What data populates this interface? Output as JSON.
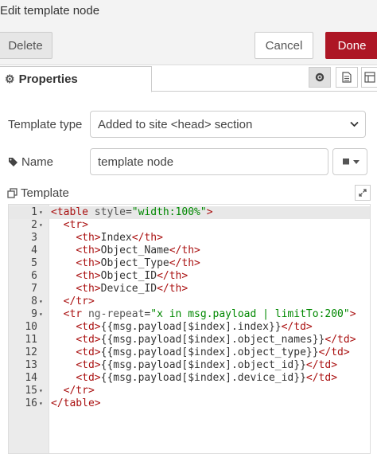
{
  "header": {
    "title": "Edit template node"
  },
  "toolbar": {
    "delete_label": "Delete",
    "cancel_label": "Cancel",
    "done_label": "Done"
  },
  "tabs": {
    "properties_label": "Properties",
    "icons": [
      "gear-icon",
      "document-icon",
      "layout-icon"
    ]
  },
  "form": {
    "template_type_label": "Template type",
    "template_type_value": "Added to site <head> section",
    "name_label": "Name",
    "name_value": "template node",
    "template_label": "Template"
  },
  "editor": {
    "lines": [
      {
        "num": "1",
        "fold": true,
        "tokens": [
          [
            "t",
            "<table "
          ],
          [
            "a",
            "style"
          ],
          [
            "x",
            "="
          ],
          [
            "s",
            "\"width:100%\""
          ],
          [
            "t",
            ">"
          ]
        ]
      },
      {
        "num": "2",
        "fold": true,
        "tokens": [
          [
            "x",
            "  "
          ],
          [
            "t",
            "<tr>"
          ]
        ]
      },
      {
        "num": "3",
        "fold": false,
        "tokens": [
          [
            "x",
            "    "
          ],
          [
            "t",
            "<th>"
          ],
          [
            "x",
            "Index"
          ],
          [
            "t",
            "</th>"
          ]
        ]
      },
      {
        "num": "4",
        "fold": false,
        "tokens": [
          [
            "x",
            "    "
          ],
          [
            "t",
            "<th>"
          ],
          [
            "x",
            "Object_Name"
          ],
          [
            "t",
            "</th>"
          ]
        ]
      },
      {
        "num": "5",
        "fold": false,
        "tokens": [
          [
            "x",
            "    "
          ],
          [
            "t",
            "<th>"
          ],
          [
            "x",
            "Object_Type"
          ],
          [
            "t",
            "</th>"
          ]
        ]
      },
      {
        "num": "6",
        "fold": false,
        "tokens": [
          [
            "x",
            "    "
          ],
          [
            "t",
            "<th>"
          ],
          [
            "x",
            "Object_ID"
          ],
          [
            "t",
            "</th>"
          ]
        ]
      },
      {
        "num": "7",
        "fold": false,
        "tokens": [
          [
            "x",
            "    "
          ],
          [
            "t",
            "<th>"
          ],
          [
            "x",
            "Device_ID"
          ],
          [
            "t",
            "</th>"
          ]
        ]
      },
      {
        "num": "8",
        "fold": true,
        "tokens": [
          [
            "x",
            "  "
          ],
          [
            "t",
            "</tr>"
          ]
        ]
      },
      {
        "num": "9",
        "fold": true,
        "tokens": [
          [
            "x",
            "  "
          ],
          [
            "t",
            "<tr "
          ],
          [
            "a",
            "ng-repeat"
          ],
          [
            "x",
            "="
          ],
          [
            "s",
            "\"x in msg.payload | limitTo:200\""
          ],
          [
            "t",
            ">"
          ]
        ]
      },
      {
        "num": "10",
        "fold": false,
        "tokens": [
          [
            "x",
            "    "
          ],
          [
            "t",
            "<td>"
          ],
          [
            "x",
            "{{msg.payload[$index].index}}"
          ],
          [
            "t",
            "</td>"
          ]
        ]
      },
      {
        "num": "11",
        "fold": false,
        "tokens": [
          [
            "x",
            "    "
          ],
          [
            "t",
            "<td>"
          ],
          [
            "x",
            "{{msg.payload[$index].object_names}}"
          ],
          [
            "t",
            "</td>"
          ]
        ]
      },
      {
        "num": "12",
        "fold": false,
        "tokens": [
          [
            "x",
            "    "
          ],
          [
            "t",
            "<td>"
          ],
          [
            "x",
            "{{msg.payload[$index].object_type}}"
          ],
          [
            "t",
            "</td>"
          ]
        ]
      },
      {
        "num": "13",
        "fold": false,
        "tokens": [
          [
            "x",
            "    "
          ],
          [
            "t",
            "<td>"
          ],
          [
            "x",
            "{{msg.payload[$index].object_id}}"
          ],
          [
            "t",
            "</td>"
          ]
        ]
      },
      {
        "num": "14",
        "fold": false,
        "tokens": [
          [
            "x",
            "    "
          ],
          [
            "t",
            "<td>"
          ],
          [
            "x",
            "{{msg.payload[$index].device_id}}"
          ],
          [
            "t",
            "</td>"
          ]
        ]
      },
      {
        "num": "15",
        "fold": true,
        "tokens": [
          [
            "x",
            "  "
          ],
          [
            "t",
            "</tr>"
          ]
        ]
      },
      {
        "num": "16",
        "fold": true,
        "tokens": [
          [
            "t",
            "</table>"
          ]
        ]
      }
    ]
  }
}
